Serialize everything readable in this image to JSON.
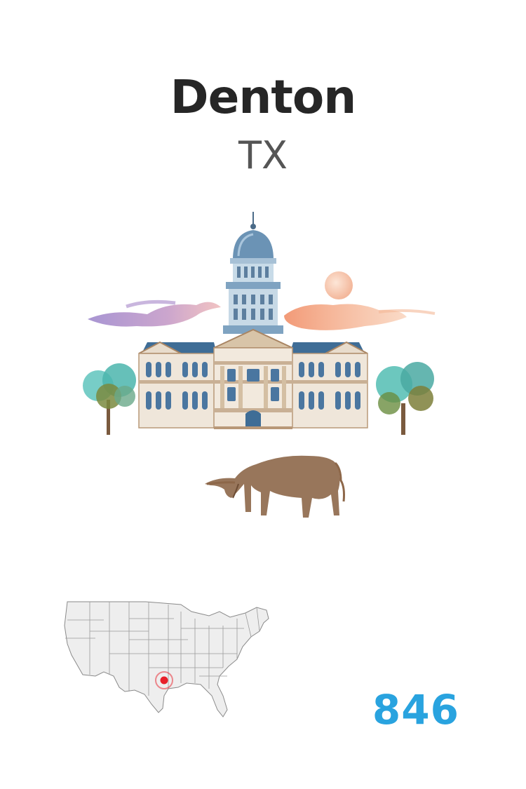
{
  "city": {
    "name": "Denton",
    "state": "TX"
  },
  "number": "846",
  "colors": {
    "title": "#262626",
    "subtitle": "#555555",
    "number": "#29a3df",
    "marker": "#e8202a"
  },
  "icons": [
    "courthouse-illustration",
    "longhorn-illustration",
    "tree-illustration",
    "sun-illustration",
    "us-map"
  ]
}
